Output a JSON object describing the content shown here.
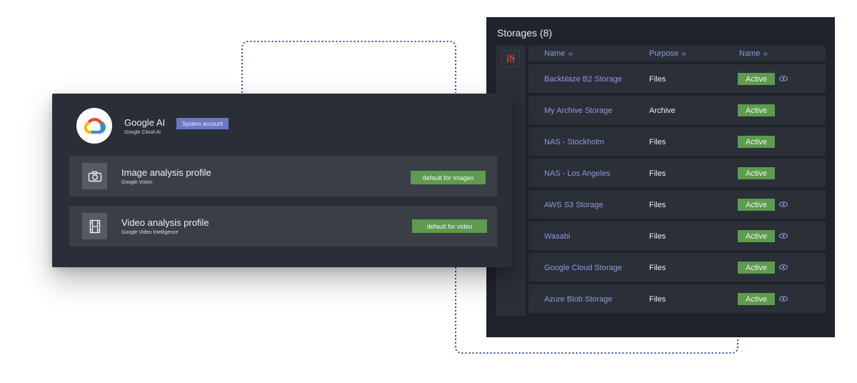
{
  "storages": {
    "title": "Storages (8)",
    "headers": {
      "name": "Name",
      "purpose": "Purpose",
      "status": "Name"
    },
    "rows": [
      {
        "name": "Backblaze B2 Storage",
        "purpose": "Files",
        "status": "Active",
        "eye": true
      },
      {
        "name": "My Archive Storage",
        "purpose": "Archive",
        "status": "Active",
        "eye": false
      },
      {
        "name": "NAS - Stockholm",
        "purpose": "Files",
        "status": "Active",
        "eye": false
      },
      {
        "name": "NAS - Los Angeles",
        "purpose": "Files",
        "status": "Active",
        "eye": false
      },
      {
        "name": "AWS S3 Storage",
        "purpose": "Files",
        "status": "Active",
        "eye": true
      },
      {
        "name": "Wasabi",
        "purpose": "Files",
        "status": "Active",
        "eye": true
      },
      {
        "name": "Google Cloud Storage",
        "purpose": "Files",
        "status": "Active",
        "eye": true
      },
      {
        "name": "Azure Blob Storage",
        "purpose": "Files",
        "status": "Active",
        "eye": true
      }
    ]
  },
  "google_ai": {
    "title": "Google AI",
    "subtitle": "Google Cloud AI",
    "badge": "System account",
    "profiles": [
      {
        "title": "Image analysis profile",
        "subtitle": "Google Vision",
        "default_label": "default for images",
        "icon": "camera-icon"
      },
      {
        "title": "Video analysis profile",
        "subtitle": "Google Video Intelligence",
        "default_label": "default for video",
        "icon": "film-icon"
      }
    ]
  },
  "colors": {
    "active_green": "#5e9a4f",
    "link_blue": "#8f9bdb",
    "badge_purple": "#6b78c4",
    "connector_blue": "#2f4f9a"
  }
}
